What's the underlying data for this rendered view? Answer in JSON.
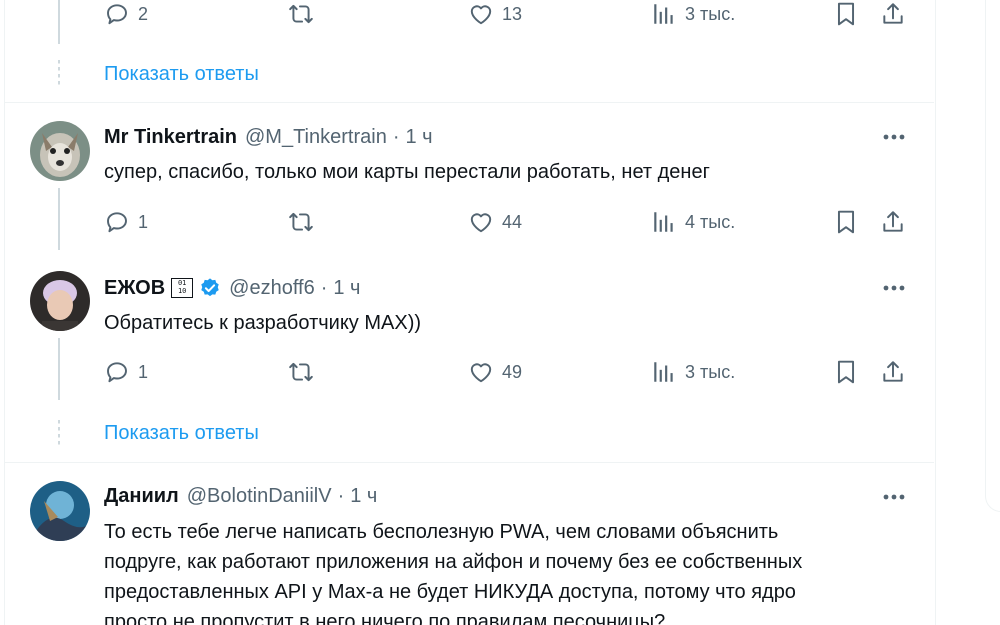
{
  "colors": {
    "accent": "#1d9bf0",
    "text": "#0f1419",
    "muted": "#536471",
    "border": "#eff3f4"
  },
  "top_actions": {
    "replies": "2",
    "likes": "13",
    "views": "3 тыс."
  },
  "show_replies_1": "Показать ответы",
  "tweets": [
    {
      "name": "Mr Tinkertrain",
      "handle": "@M_Tinkertrain",
      "dot": "·",
      "time": "1 ч",
      "text": "супер, спасибо, только мои карты перестали работать, нет денег",
      "replies": "1",
      "likes": "44",
      "views": "4 тыс."
    },
    {
      "name": "ЕЖОВ",
      "badge": "🆘",
      "handle": "@ezhoff6",
      "dot": "·",
      "time": "1 ч",
      "text": "Обратитесь к разработчику MAX))",
      "replies": "1",
      "likes": "49",
      "views": "3 тыс."
    },
    {
      "name": "Даниил",
      "handle": "@BolotinDaniilV",
      "dot": "·",
      "time": "1 ч",
      "text_lines": [
        "То есть тебе легче написать бесполезную PWA, чем словами объяснить",
        "подруге, как работают приложения на айфон и почему без ее собственных",
        "предоставленных API у Max-а не будет НИКУДА доступа, потому что ядро",
        "просто не пропустит в него ничего по правилам песочницы?"
      ]
    }
  ],
  "show_replies_2": "Показать ответы",
  "icons": [
    "reply-icon",
    "retweet-icon",
    "like-icon",
    "views-icon",
    "bookmark-icon",
    "share-icon",
    "more-icon",
    "verified-icon"
  ]
}
